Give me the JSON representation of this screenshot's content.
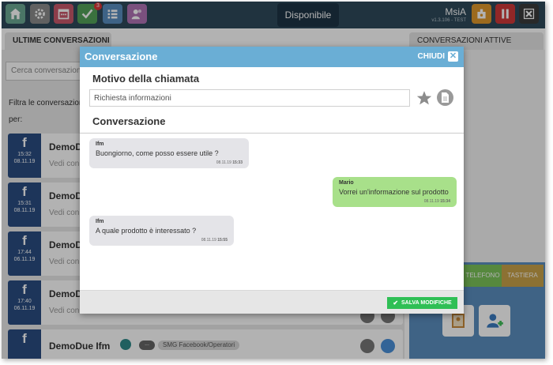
{
  "topbar": {
    "status": "Disponibile",
    "user_name": "MsiA",
    "user_version": "v1.3.106 - TEST",
    "tasks_badge": "3",
    "colors": {
      "bar": "#2f4a5b",
      "status_pill": "#1d3445"
    },
    "icons": [
      "home-icon",
      "gear-icon",
      "calendar-icon",
      "check-icon",
      "list-icon",
      "contacts-icon",
      "id-badge-icon",
      "pause-icon",
      "close-icon"
    ]
  },
  "left_panel": {
    "tab_label": "ULTIME CONVERSAZIONI",
    "search_placeholder": "Cerca conversazioni",
    "filter_label_1": "Filtra le conversazioni",
    "filter_label_2": "per:",
    "rows": [
      {
        "channel": "f",
        "time": "15:32",
        "date": "08.11.19",
        "name": "DemoD",
        "preview": "Vedi con"
      },
      {
        "channel": "f",
        "time": "15:31",
        "date": "08.11.19",
        "name": "DemoD",
        "preview": "Vedi con"
      },
      {
        "channel": "f",
        "time": "17:44",
        "date": "06.11.19",
        "name": "DemoD",
        "preview": "Vedi con"
      },
      {
        "channel": "f",
        "time": "17:40",
        "date": "06.11.19",
        "name": "DemoD",
        "preview": "Vedi con"
      },
      {
        "channel": "f",
        "time": "",
        "date": "",
        "name": "DemoDue Ifm",
        "preview": "",
        "tag_dots": "...",
        "tag_label": "SMG Facebook/Operatori"
      }
    ]
  },
  "right_panel": {
    "tab_label": "CONVERSAZIONI ATTIVE",
    "tab_telefono": "TELEFONO",
    "tab_tastiera": "TASTIERA"
  },
  "modal": {
    "title": "Conversazione",
    "close_label": "CHIUDI",
    "close_glyph": "✕",
    "reason_heading": "Motivo della chiamata",
    "reason_value": "Richiesta informazioni",
    "conversation_heading": "Conversazione",
    "save_label": "SALVA MODIFICHE",
    "save_glyph": "✔",
    "colors": {
      "header": "#6aaed5",
      "incoming": "#e4e4e8",
      "outgoing": "#a8e08a",
      "save": "#2fbf55"
    },
    "messages": [
      {
        "direction": "in",
        "author": "Ifm",
        "text": "Buongiorno, come posso essere utile ?",
        "date": "08.11.19",
        "time": "15:33"
      },
      {
        "direction": "out",
        "author": "Mario",
        "text": "Vorrei un'informazione sul prodotto",
        "date": "08.11.19",
        "time": "15:34"
      },
      {
        "direction": "in",
        "author": "Ifm",
        "text": "A quale prodotto è interessato ?",
        "date": "08.11.19",
        "time": "15:55"
      }
    ]
  }
}
